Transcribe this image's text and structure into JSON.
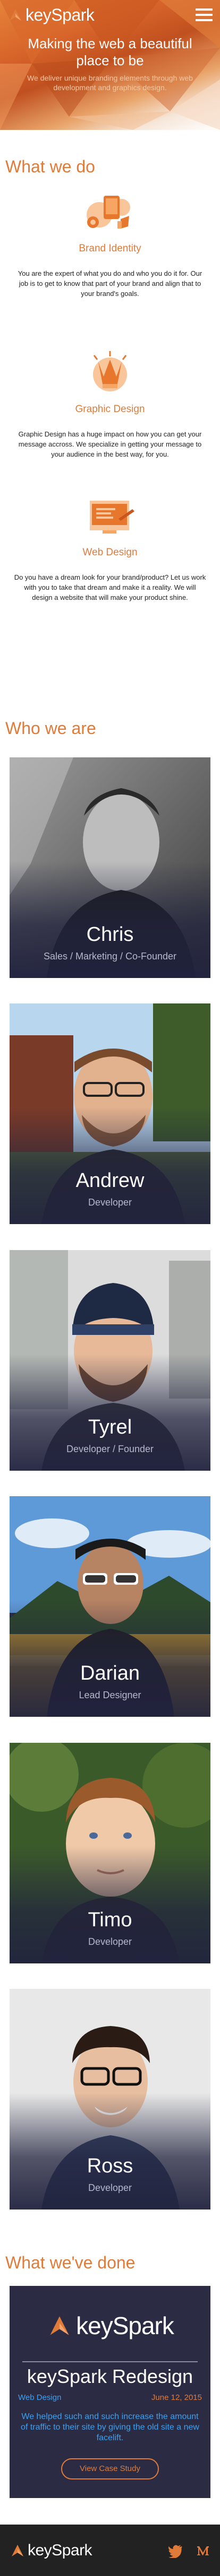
{
  "header": {
    "brand": "keySpark",
    "menu_icon": "hamburger-icon",
    "headline": "Making the web a beautiful place to be",
    "subhead": "We deliver unique branding elements through web development and graphics design."
  },
  "what_we_do": {
    "title": "What we do",
    "services": [
      {
        "icon": "brand-identity-icon",
        "name": "Brand Identity",
        "text": "You are the expert of what you do and who you do it for. Our job is to get to know that part of your brand and align that to your brand's goals."
      },
      {
        "icon": "graphic-design-icon",
        "name": "Graphic Design",
        "text": "Graphic Design has a huge impact on how you can get your message accross. We specialize in getting your message to your audience in the best way, for you."
      },
      {
        "icon": "web-design-icon",
        "name": "Web Design",
        "text": "Do you have a dream look for your brand/product? Let us work with you to take that dream and make it a reality. We will design a website that will make your product shine."
      }
    ]
  },
  "who_we_are": {
    "title": "Who we are",
    "team": [
      {
        "name": "Chris",
        "role": "Sales / Marketing / Co-Founder"
      },
      {
        "name": "Andrew",
        "role": "Developer"
      },
      {
        "name": "Tyrel",
        "role": "Developer / Founder"
      },
      {
        "name": "Darian",
        "role": "Lead Designer"
      },
      {
        "name": "Timo",
        "role": "Developer"
      },
      {
        "name": "Ross",
        "role": "Developer"
      }
    ]
  },
  "what_weve_done": {
    "title": "What we've done",
    "project": {
      "logo_text": "keySpark",
      "title": "keySpark Redesign",
      "tag": "Web Design",
      "date": "June 12, 2015",
      "description": "We helped such and such increase the amount of traffic to their site by giving the old site a new facelift.",
      "button": "View Case Study"
    }
  },
  "footer": {
    "brand": "keySpark",
    "social": [
      "twitter-icon",
      "medium-icon"
    ]
  },
  "colors": {
    "accent": "#e07b39",
    "card_bg": "#2b2c44",
    "link_blue": "#3ea0f0",
    "footer_bg": "#222222"
  }
}
